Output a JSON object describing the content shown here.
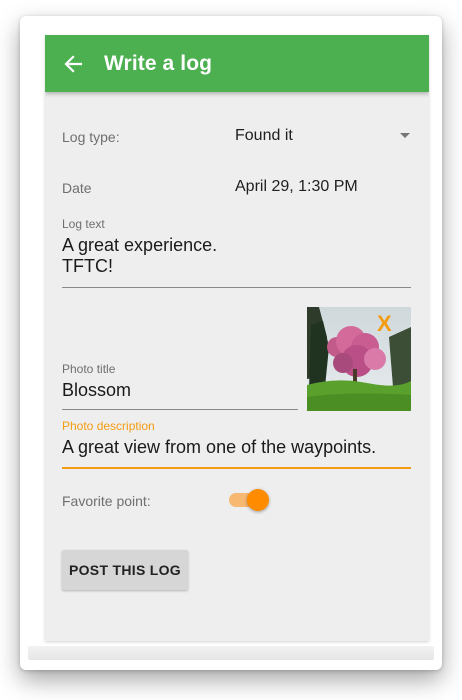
{
  "header": {
    "title": "Write a log",
    "back_icon": "arrow-left-icon"
  },
  "form": {
    "log_type": {
      "label": "Log type:",
      "value": "Found it"
    },
    "date": {
      "label": "Date",
      "value": "April 29, 1:30 PM"
    },
    "log_text": {
      "label": "Log text",
      "line1": "A great experience.",
      "line2": "TFTC!"
    },
    "photo_title": {
      "label": "Photo title",
      "value": "Blossom"
    },
    "photo_description": {
      "label": "Photo description",
      "value": "A great view from one of the waypoints."
    },
    "photo": {
      "remove_label": "X"
    },
    "favorite": {
      "label": "Favorite point:",
      "enabled": true
    },
    "submit_label": "POST THIS LOG"
  },
  "colors": {
    "appbar": "#4caf50",
    "accent": "#ff8c00",
    "background": "#eeeeee"
  }
}
